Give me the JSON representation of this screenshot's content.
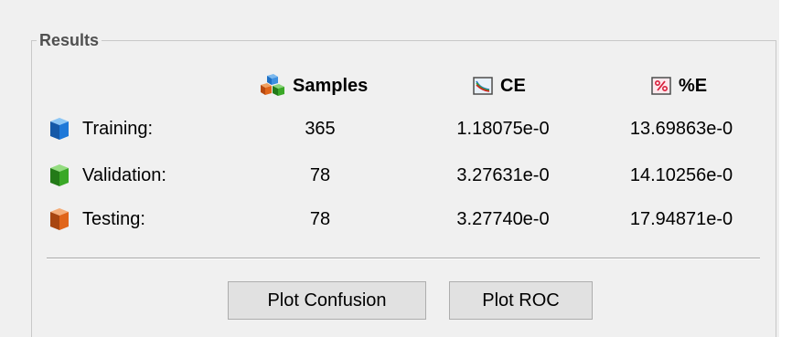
{
  "results": {
    "title": "Results",
    "columns": {
      "samples": "Samples",
      "ce": "CE",
      "percent_error": "%E"
    },
    "rows": [
      {
        "label": "Training:",
        "icon": "blue-cube-icon",
        "samples": "365",
        "ce": "1.18075e-0",
        "percent_error": "13.69863e-0"
      },
      {
        "label": "Validation:",
        "icon": "green-cube-icon",
        "samples": "78",
        "ce": "3.27631e-0",
        "percent_error": "14.10256e-0"
      },
      {
        "label": "Testing:",
        "icon": "orange-cube-icon",
        "samples": "78",
        "ce": "3.27740e-0",
        "percent_error": "17.94871e-0"
      }
    ],
    "buttons": {
      "plot_confusion": "Plot Confusion",
      "plot_roc": "Plot ROC"
    }
  },
  "colors": {
    "training": "#1e78d8",
    "validation": "#3aa827",
    "testing": "#e0651a"
  }
}
